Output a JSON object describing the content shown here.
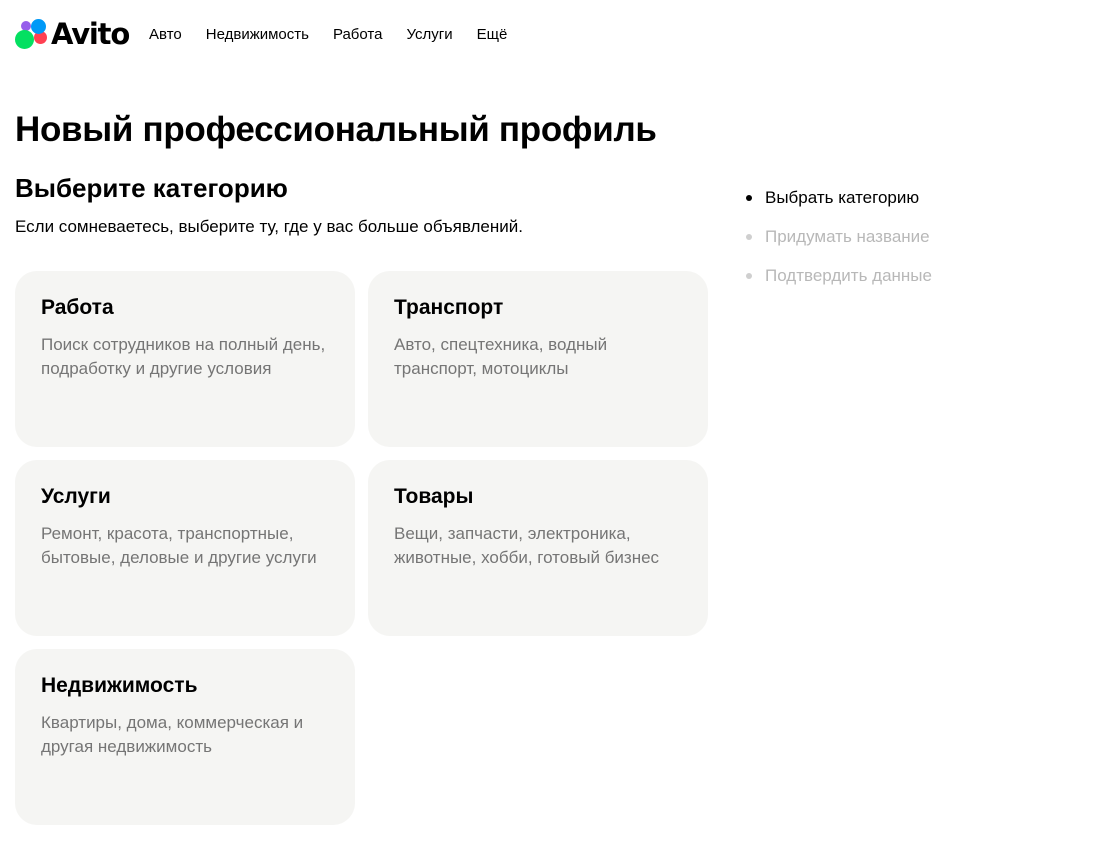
{
  "header": {
    "logo_text": "Avito",
    "logo_colors": [
      "#965eeb",
      "#ff4053",
      "#0099f7",
      "#04e061"
    ],
    "nav": [
      {
        "label": "Авто"
      },
      {
        "label": "Недвижимость"
      },
      {
        "label": "Работа"
      },
      {
        "label": "Услуги"
      },
      {
        "label": "Ещё"
      }
    ]
  },
  "main": {
    "title": "Новый профессиональный профиль",
    "section_title": "Выберите категорию",
    "section_subtitle": "Если сомневаетесь, выберите ту, где у вас больше объявлений.",
    "categories": [
      {
        "title": "Работа",
        "description": "Поиск сотрудников на полный день, подработку и другие условия"
      },
      {
        "title": "Транспорт",
        "description": "Авто, спецтехника, водный транспорт, мотоциклы"
      },
      {
        "title": "Услуги",
        "description": "Ремонт, красота, транспортные, бытовые, деловые и другие услуги"
      },
      {
        "title": "Товары",
        "description": "Вещи, запчасти, электроника, животные, хобби, готовый бизнес"
      },
      {
        "title": "Недвижимость",
        "description": "Квартиры, дома, коммерческая и другая недвижимость"
      }
    ]
  },
  "steps": [
    {
      "label": "Выбрать категорию",
      "state": "active"
    },
    {
      "label": "Придумать название",
      "state": "inactive"
    },
    {
      "label": "Подтвердить данные",
      "state": "inactive"
    }
  ],
  "colors": {
    "card_background": "#f5f5f3",
    "muted_text": "#757575",
    "inactive_step": "#b8b8b8"
  }
}
